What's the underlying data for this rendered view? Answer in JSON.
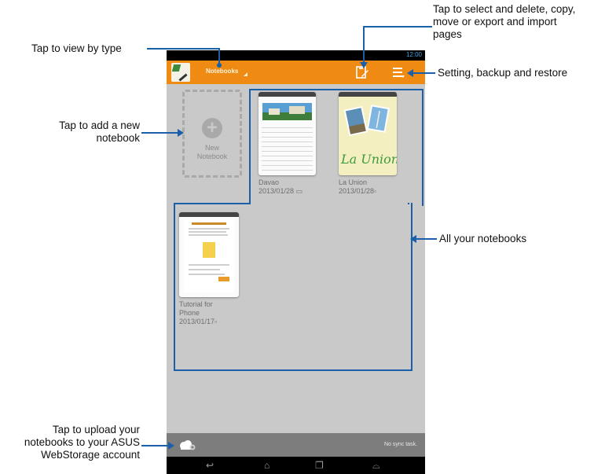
{
  "callouts": {
    "view_by_type": "Tap to view by type",
    "add_notebook": [
      "Tap to add a new",
      "notebook"
    ],
    "select_delete": [
      "Tap to select and delete, copy,",
      "move or export and import",
      "pages"
    ],
    "settings": "Setting, backup and restore",
    "all_notebooks": "All your notebooks",
    "upload": [
      "Tap to upload your",
      "notebooks to your ASUS",
      "WebStorage account"
    ]
  },
  "status_bar": {
    "time": "12:00"
  },
  "action_bar": {
    "spinner_label": "Notebooks",
    "icons": [
      "app-icon",
      "edit-icon",
      "menu-icon"
    ]
  },
  "new_notebook": {
    "label_line1": "New",
    "label_line2": "Notebook"
  },
  "notebooks": [
    {
      "name": "Davao",
      "date": "2013/01/28"
    },
    {
      "name": "La Union",
      "date": "2013/01/28",
      "cover_text": "La Union"
    },
    {
      "name_line1": "Tutorial for",
      "name_line2": "Phone",
      "date": "2013/01/17"
    }
  ],
  "bottom_bar": {
    "sync_status": "No sync task."
  },
  "colors": {
    "action_bar": "#ef8a12",
    "callout_line": "#1a5fa8",
    "background": "#c9c9c9"
  }
}
